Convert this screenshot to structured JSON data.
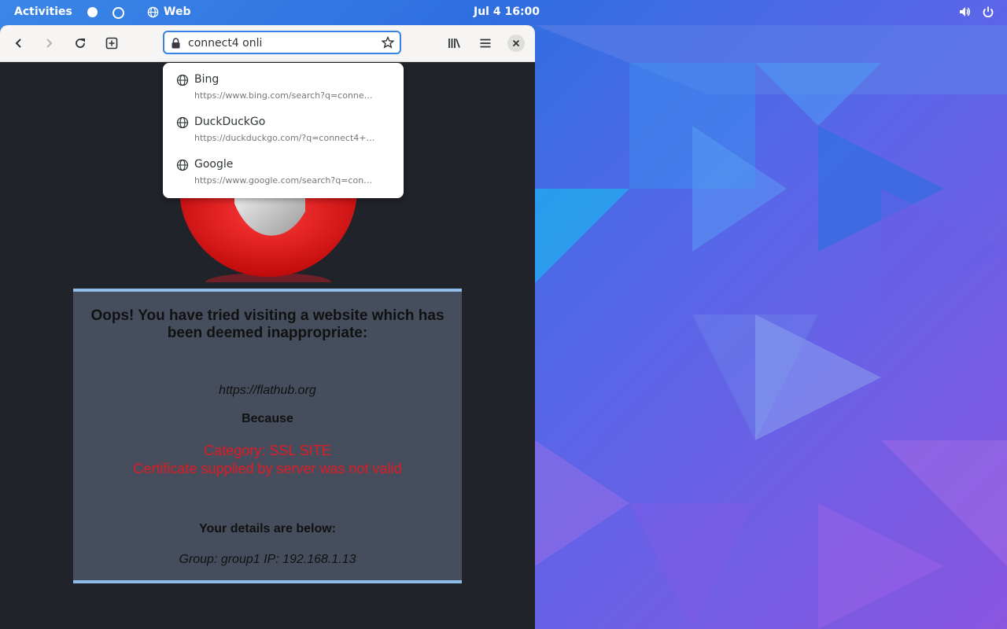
{
  "topbar": {
    "activities": "Activities",
    "app_name": "Web",
    "clock": "Jul 4  16:00"
  },
  "browser": {
    "url_value": "connect4 onli",
    "suggestions": [
      {
        "name": "Bing",
        "url": "https://www.bing.com/search?q=conne…"
      },
      {
        "name": "DuckDuckGo",
        "url": "https://duckduckgo.com/?q=connect4+…"
      },
      {
        "name": "Google",
        "url": "https://www.google.com/search?q=con…"
      }
    ]
  },
  "block_page": {
    "headline": "Oops! You have tried visiting a website which has been deemed inappropriate:",
    "url": "https://flathub.org",
    "because": "Because",
    "category_line1": "Category: SSL SITE",
    "category_line2": "Certificate supplied by server was not valid",
    "details_heading": "Your details are below:",
    "details": "Group: group1   IP: 192.168.1.13"
  },
  "colors": {
    "accent": "#3584e4",
    "panel_bg": "#464d5c",
    "panel_border": "#8fbce8",
    "error_red": "#e01b24",
    "page_bg": "#20232a"
  }
}
